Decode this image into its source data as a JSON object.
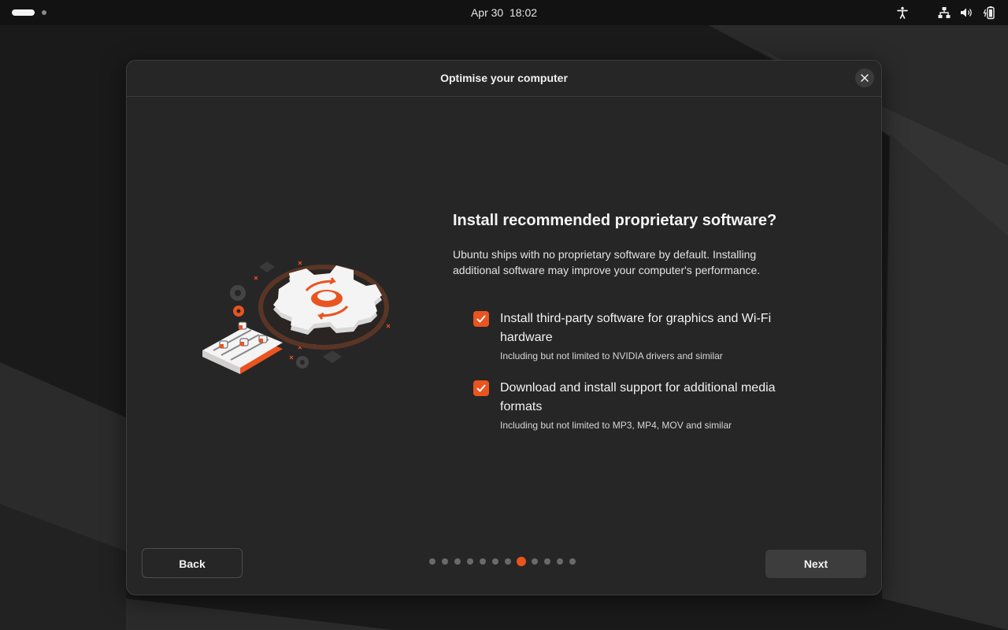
{
  "topbar": {
    "date": "Apr 30",
    "time": "18:02",
    "icons": [
      "accessibility-icon",
      "network-icon",
      "volume-icon",
      "battery-icon"
    ]
  },
  "dialog": {
    "title": "Optimise your computer",
    "heading": "Install recommended proprietary software?",
    "description": "Ubuntu ships with no proprietary software by default. Installing additional software may improve your computer's performance.",
    "options": [
      {
        "label": "Install third-party software for graphics and Wi-Fi hardware",
        "sublabel": "Including but not limited to NVIDIA drivers and similar",
        "checked": true
      },
      {
        "label": "Download and install support for additional media formats",
        "sublabel": "Including but not limited to MP3, MP4, MOV and similar",
        "checked": true
      }
    ],
    "back_label": "Back",
    "next_label": "Next",
    "pager": {
      "total": 12,
      "current": 8
    }
  },
  "colors": {
    "accent": "#e95420",
    "dialog_bg": "#262626",
    "topbar_bg": "#121212"
  }
}
